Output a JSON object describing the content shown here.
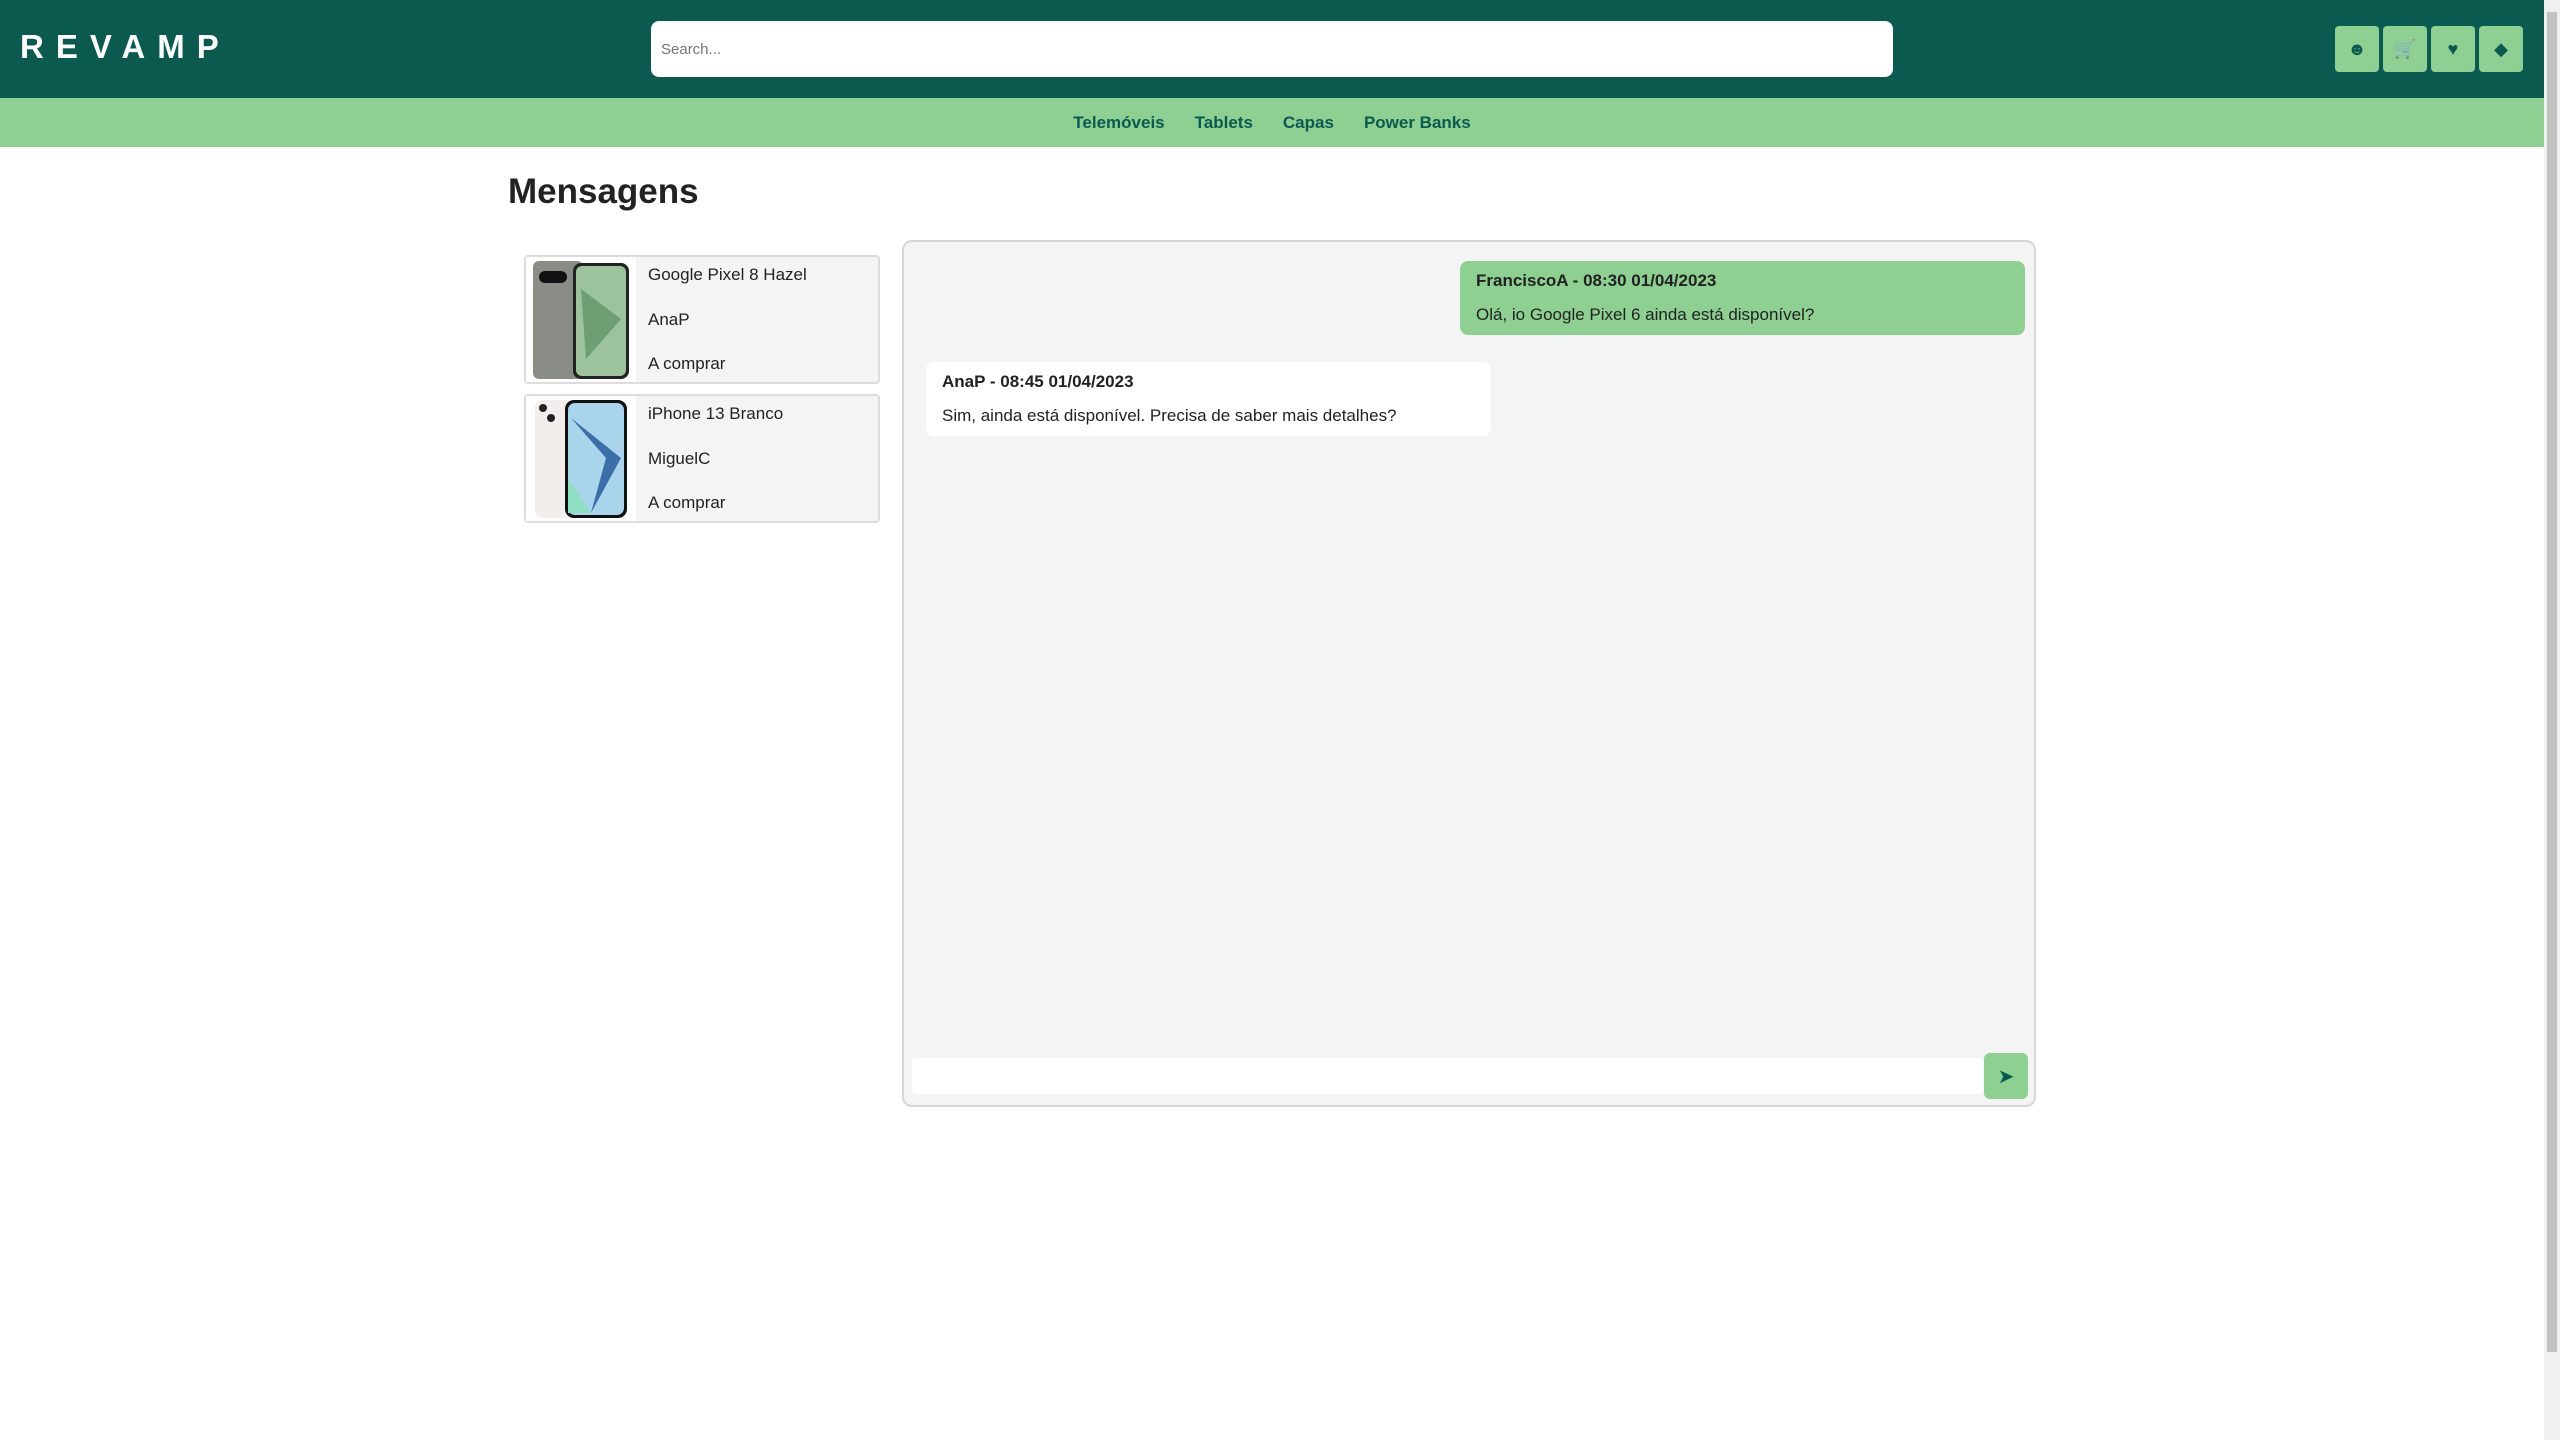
{
  "header": {
    "logo": "REVAMP",
    "search_placeholder": "Search...",
    "icons": [
      "user-icon",
      "cart-icon",
      "heart-icon",
      "tag-icon"
    ]
  },
  "nav": {
    "items": [
      "Telemóveis",
      "Tablets",
      "Capas",
      "Power Banks"
    ]
  },
  "page": {
    "title": "Mensagens"
  },
  "conversations": [
    {
      "product": "Google Pixel 8 Hazel",
      "user": "AnaP",
      "status": "A comprar"
    },
    {
      "product": "iPhone 13 Branco",
      "user": "MiguelC",
      "status": "A comprar"
    }
  ],
  "messages": [
    {
      "header": "FranciscoA - 08:30 01/04/2023",
      "text": "Olá, io Google Pixel 6 ainda está disponível?"
    },
    {
      "header": "AnaP - 08:45 01/04/2023",
      "text": "Sim, ainda está disponível. Precisa de saber mais detalhes?"
    }
  ],
  "composer": {
    "value": "",
    "send_icon": "send-icon"
  },
  "colors": {
    "primary": "#0b5a50",
    "accent": "#8ecf92",
    "panel": "#f4f4f4"
  }
}
